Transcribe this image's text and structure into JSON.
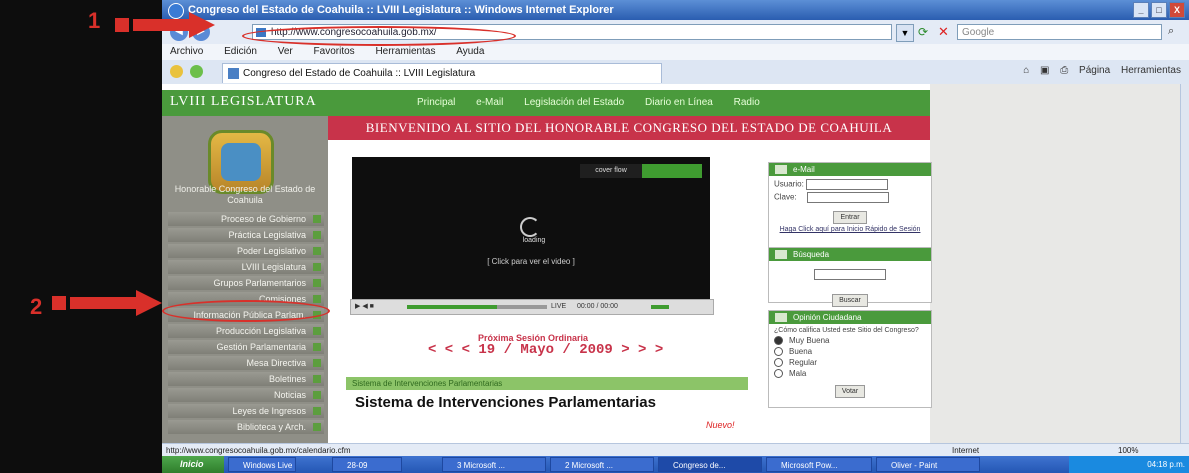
{
  "window": {
    "title": "Congreso del Estado de Coahuila :: LVIII Legislatura :: Windows Internet Explorer",
    "controls": [
      "_",
      "□",
      "X"
    ]
  },
  "addressbar": {
    "url": "http://www.congresocoahuila.gob.mx/",
    "search_placeholder": "Google"
  },
  "menubar": [
    "Archivo",
    "Edición",
    "Ver",
    "Favoritos",
    "Herramientas",
    "Ayuda"
  ],
  "tab": {
    "title": "Congreso del Estado de Coahuila :: LVIII Legislatura"
  },
  "toolbar": {
    "page": "Página",
    "tools": "Herramientas"
  },
  "site": {
    "logo": "LVIII LEGISLATURA",
    "nav": [
      "Principal",
      "e-Mail",
      "Legislación del Estado",
      "Diario en Línea",
      "Radio"
    ],
    "side_caption": "Honorable Congreso del Estado de Coahuila",
    "side_menu": [
      "Proceso de Gobierno",
      "Práctica Legislativa",
      "Poder Legislativo",
      "LVIII Legislatura",
      "Grupos Parlamentarios",
      "Comisiones",
      "Información Pública Parlam.",
      "Producción Legislativa",
      "Gestión Parlamentaria",
      "Mesa Directiva",
      "Boletines",
      "Noticias",
      "Leyes de Ingresos",
      "Biblioteca y Arch."
    ],
    "banner": "BIENVENIDO AL SITIO DEL HONORABLE CONGRESO DEL ESTADO DE COAHUILA",
    "video": {
      "badge": "cover flow",
      "loading": "loading",
      "click_text": "[ Click para ver el video ]",
      "live": "LIVE",
      "time": "00:00 / 00:00"
    },
    "next_label": "Próxima Sesión Ordinaria",
    "next_date": "< < < 19 / Mayo / 2009 > > >",
    "interventions_bar": "Sistema de Intervenciones Parlamentarias",
    "interventions_title": "Sistema de Intervenciones Parlamentarias",
    "new_label": "Nuevo!",
    "email_widget": {
      "title": "e-Mail",
      "user_label": "Usuario:",
      "pass_label": "Clave:",
      "button": "Entrar",
      "help": "Haga Click aquí para Inicio Rápido de Sesión"
    },
    "search_widget": {
      "title": "Búsqueda",
      "button": "Buscar"
    },
    "poll_widget": {
      "title": "Opinión Ciudadana",
      "question": "¿Cómo califica Usted este Sitio del Congreso?",
      "options": [
        "Muy Buena",
        "Buena",
        "Regular",
        "Mala"
      ],
      "button": "Votar"
    }
  },
  "statusbar": {
    "url": "http://www.congresocoahuila.gob.mx/calendario.cfm",
    "zone": "Internet",
    "zoom": "100%"
  },
  "taskbar": {
    "start": "Inicio",
    "items": [
      "Windows Live ...",
      "28-09",
      "3 Microsoft ...",
      "2 Microsoft ...",
      "Congreso de...",
      "Microsoft Pow...",
      "Oliver - Paint"
    ],
    "clock": "04:18 p.m."
  },
  "annotations": [
    "1",
    "2"
  ]
}
